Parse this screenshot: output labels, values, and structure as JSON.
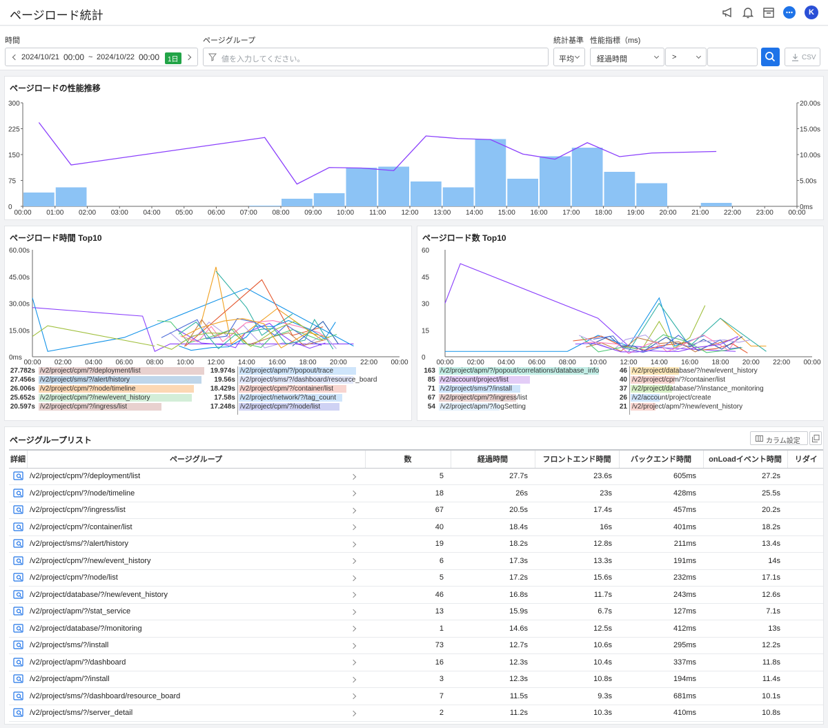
{
  "header": {
    "title": "ページロード統計",
    "avatar": "K"
  },
  "filters": {
    "time_label": "時間",
    "date_from": "2024/10/21",
    "time_from": "00:00",
    "sep": "~",
    "date_to": "2024/10/22",
    "time_to": "00:00",
    "range_badge": "1日",
    "group_label": "ページグループ",
    "group_placeholder": "値を入力してください。",
    "stat_label": "統計基準",
    "stat_value": "平均",
    "metric_label": "性能指標（ms)",
    "metric_value": "経過時間",
    "op_value": ">",
    "threshold_value": "",
    "csv_label": "CSV"
  },
  "trend": {
    "title": "ページロードの性能推移",
    "left_ticks": [
      "300",
      "225",
      "150",
      "75",
      "0"
    ],
    "right_ticks": [
      "20.00s",
      "15.00s",
      "10.00s",
      "5.00s",
      "0ms"
    ],
    "x_labels": [
      "00:00",
      "01:00",
      "02:00",
      "03:00",
      "04:00",
      "05:00",
      "06:00",
      "07:00",
      "08:00",
      "09:00",
      "10:00",
      "11:00",
      "12:00",
      "13:00",
      "14:00",
      "15:00",
      "16:00",
      "17:00",
      "18:00",
      "19:00",
      "20:00",
      "21:00",
      "22:00",
      "23:00",
      "00:00"
    ],
    "bar_color": "#8cc3f5",
    "line_color": "#8a3ffc"
  },
  "chart_data": [
    {
      "type": "bar",
      "title": "ページロードの性能推移",
      "categories": [
        "00:00",
        "01:00",
        "02:00",
        "03:00",
        "04:00",
        "05:00",
        "06:00",
        "07:00",
        "08:00",
        "09:00",
        "10:00",
        "11:00",
        "12:00",
        "13:00",
        "14:00",
        "15:00",
        "16:00",
        "17:00",
        "18:00",
        "19:00",
        "20:00",
        "21:00",
        "22:00",
        "23:00"
      ],
      "series": [
        {
          "values": [
            40,
            55,
            0,
            0,
            0,
            0,
            0,
            2,
            22,
            38,
            112,
            115,
            72,
            55,
            195,
            80,
            145,
            170,
            100,
            67,
            0,
            10,
            0,
            0
          ],
          "axis": "left"
        },
        {
          "type": "line",
          "values": [
            16.2,
            8.0,
            null,
            null,
            null,
            null,
            null,
            13.3,
            4.3,
            7.5,
            7.4,
            6.9,
            13.6,
            13.1,
            12.9,
            10.1,
            9.1,
            12.3,
            9.6,
            10.3,
            null,
            10.6,
            null,
            null
          ],
          "unit": "s",
          "axis": "right"
        }
      ],
      "ylim_left": [
        0,
        300
      ],
      "ylim_right": [
        0,
        20
      ]
    },
    {
      "type": "line",
      "title": "ページロード時間 Top10",
      "ytick_labels": [
        "60.00s",
        "45.00s",
        "30.00s",
        "15.00s",
        "0ms"
      ]
    },
    {
      "type": "line",
      "title": "ページロード数 Top10",
      "ytick_labels": [
        "60",
        "45",
        "30",
        "15",
        "0"
      ]
    }
  ],
  "top_time": {
    "title": "ページロード時間 Top10",
    "x_labels": [
      "00:00",
      "02:00",
      "04:00",
      "06:00",
      "08:00",
      "10:00",
      "12:00",
      "14:00",
      "16:00",
      "18:00",
      "20:00",
      "22:00",
      "00:00"
    ],
    "left": [
      {
        "value": "27.782s",
        "label": "/v2/project/cpm/?/deployment/list",
        "color": "#e8d1cf"
      },
      {
        "value": "27.456s",
        "label": "/v2/project/sms/?/alert/history",
        "color": "#bfd6ea"
      },
      {
        "value": "26.006s",
        "label": "/v2/project/cpm/?/node/timeline",
        "color": "#fcd8b4"
      },
      {
        "value": "25.652s",
        "label": "/v2/project/cpm/?/new/event_history",
        "color": "#d3eed8"
      },
      {
        "value": "20.597s",
        "label": "/v2/project/cpm/?/ingress/list",
        "color": "#e8d1cf"
      }
    ],
    "right": [
      {
        "value": "19.974s",
        "label": "/v2/project/apm/?/popout/trace",
        "color": "#cfe5fb"
      },
      {
        "value": "19.56s",
        "label": "/v2/project/sms/?/dashboard/resource_board",
        "color": "#e3e8fb"
      },
      {
        "value": "18.429s",
        "label": "/v2/project/cpm/?/container/list",
        "color": "#f8d5d0"
      },
      {
        "value": "17.58s",
        "label": "/v2/project/network/?/tag_count",
        "color": "#cfe5fb"
      },
      {
        "value": "17.248s",
        "label": "/v2/project/cpm/?/node/list",
        "color": "#cfd2f4"
      }
    ]
  },
  "top_count": {
    "title": "ページロード数 Top10",
    "x_labels": [
      "00:00",
      "02:00",
      "04:00",
      "06:00",
      "08:00",
      "10:00",
      "12:00",
      "14:00",
      "16:00",
      "18:00",
      "20:00",
      "22:00",
      "00:00"
    ],
    "left": [
      {
        "value": "163",
        "label": "/v2/project/apm/?/popout/correlations/database_info",
        "color": "#c3eee6"
      },
      {
        "value": "85",
        "label": "/v2/account/project/list",
        "color": "#e3cdf7"
      },
      {
        "value": "71",
        "label": "/v2/project/sms/?/install",
        "color": "#cfe5fb"
      },
      {
        "value": "67",
        "label": "/v2/project/cpm/?/ingress/list",
        "color": "#e8d1cf"
      },
      {
        "value": "54",
        "label": "/v2/project/apm/?/logSetting",
        "color": "#e3f0fb"
      }
    ],
    "right": [
      {
        "value": "46",
        "label": "/v2/project/database/?/new/event_history",
        "color": "#fde7b8"
      },
      {
        "value": "40",
        "label": "/v2/project/cpm/?/container/list",
        "color": "#f8d5d0"
      },
      {
        "value": "37",
        "label": "/v2/project/database/?/instance_monitoring",
        "color": "#d8f0c6"
      },
      {
        "value": "26",
        "label": "/v2/account/project/create",
        "color": "#cfe5fb"
      },
      {
        "value": "21",
        "label": "/v2/project/apm/?/new/event_history",
        "color": "#f8d5d0"
      }
    ]
  },
  "list": {
    "title": "ページグループリスト",
    "column_settings": "カラム設定",
    "headers": [
      "詳細",
      "ページグループ",
      "数",
      "経過時間",
      "フロントエンド時間",
      "バックエンド時間",
      "onLoadイベント時間",
      "リダイ"
    ],
    "rows": [
      [
        "/v2/project/cpm/?/deployment/list",
        "5",
        "27.7s",
        "23.6s",
        "605ms",
        "27.2s"
      ],
      [
        "/v2/project/cpm/?/node/timeline",
        "18",
        "26s",
        "23s",
        "428ms",
        "25.5s"
      ],
      [
        "/v2/project/cpm/?/ingress/list",
        "67",
        "20.5s",
        "17.4s",
        "457ms",
        "20.2s"
      ],
      [
        "/v2/project/cpm/?/container/list",
        "40",
        "18.4s",
        "16s",
        "401ms",
        "18.2s"
      ],
      [
        "/v2/project/sms/?/alert/history",
        "19",
        "18.2s",
        "12.8s",
        "211ms",
        "13.4s"
      ],
      [
        "/v2/project/cpm/?/new/event_history",
        "6",
        "17.3s",
        "13.3s",
        "191ms",
        "14s"
      ],
      [
        "/v2/project/cpm/?/node/list",
        "5",
        "17.2s",
        "15.6s",
        "232ms",
        "17.1s"
      ],
      [
        "/v2/project/database/?/new/event_history",
        "46",
        "16.8s",
        "11.7s",
        "243ms",
        "12.6s"
      ],
      [
        "/v2/project/apm/?/stat_service",
        "13",
        "15.9s",
        "6.7s",
        "127ms",
        "7.1s"
      ],
      [
        "/v2/project/database/?/monitoring",
        "1",
        "14.6s",
        "12.5s",
        "412ms",
        "13s"
      ],
      [
        "/v2/project/sms/?/install",
        "73",
        "12.7s",
        "10.6s",
        "295ms",
        "12.2s"
      ],
      [
        "/v2/project/apm/?/dashboard",
        "16",
        "12.3s",
        "10.4s",
        "337ms",
        "11.8s"
      ],
      [
        "/v2/project/apm/?/install",
        "3",
        "12.3s",
        "10.8s",
        "194ms",
        "11.4s"
      ],
      [
        "/v2/project/sms/?/dashboard/resource_board",
        "7",
        "11.5s",
        "9.3s",
        "681ms",
        "10.1s"
      ],
      [
        "/v2/project/sms/?/server_detail",
        "2",
        "11.2s",
        "10.3s",
        "410ms",
        "10.8s"
      ]
    ]
  }
}
